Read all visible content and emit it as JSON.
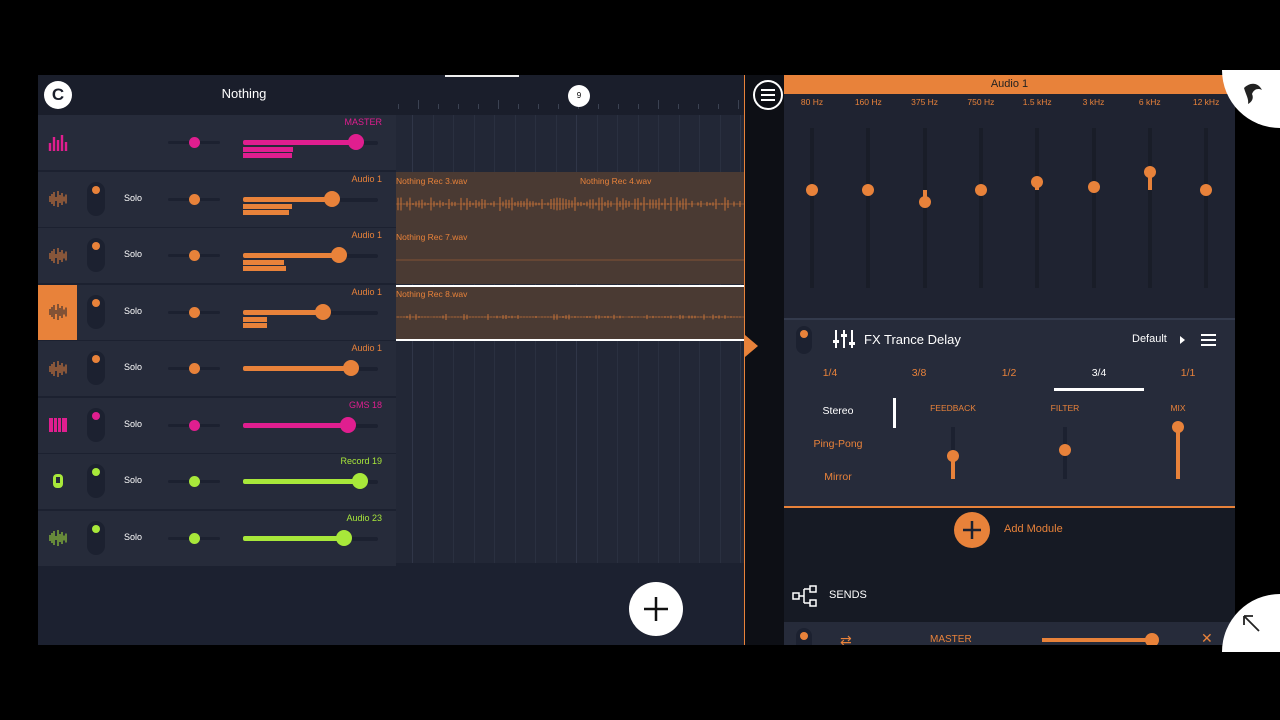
{
  "colors": {
    "accent": "#e8823a",
    "magenta": "#e01e8f",
    "lime": "#a8e83a",
    "panel": "#262b3a",
    "bg": "#1c2130"
  },
  "header": {
    "logo_icon": "fl-logo-icon",
    "project_title": "Nothing",
    "playhead_label": "9",
    "menu_icon": "hamburger-menu-icon"
  },
  "tracks": [
    {
      "name": "MASTER",
      "color": "#e01e8f",
      "icon": "mixer-bars-icon",
      "has_solo": false,
      "solo_label": "",
      "volume": 0.84,
      "meters": [
        0.75,
        0.37,
        0.36
      ],
      "selected": false
    },
    {
      "name": "Audio 1",
      "color": "#e8823a",
      "icon": "waveform-icon",
      "has_solo": true,
      "solo_label": "Solo",
      "volume": 0.66,
      "meters": [
        0.66,
        0.36,
        0.34
      ],
      "selected": false
    },
    {
      "name": "Audio 1",
      "color": "#e8823a",
      "icon": "waveform-icon",
      "has_solo": true,
      "solo_label": "Solo",
      "volume": 0.71,
      "meters": [
        0.7,
        0.3,
        0.32
      ],
      "selected": false
    },
    {
      "name": "Audio 1",
      "color": "#e8823a",
      "icon": "waveform-icon",
      "has_solo": true,
      "solo_label": "Solo",
      "volume": 0.59,
      "meters": [
        0.58,
        0.18,
        0.18
      ],
      "selected": true
    },
    {
      "name": "Audio 1",
      "color": "#e8823a",
      "icon": "waveform-icon",
      "has_solo": true,
      "solo_label": "Solo",
      "volume": 0.8,
      "meters": [
        0.8
      ],
      "selected": false
    },
    {
      "name": "GMS 18",
      "color": "#e01e8f",
      "icon": "piano-keys-icon",
      "has_solo": true,
      "solo_label": "Solo",
      "volume": 0.78,
      "meters": [
        0.78
      ],
      "selected": false
    },
    {
      "name": "Record 19",
      "color": "#a8e83a",
      "icon": "microphone-icon",
      "has_solo": true,
      "solo_label": "Solo",
      "volume": 0.87,
      "meters": [
        0.87
      ],
      "selected": false
    },
    {
      "name": "Audio 23",
      "color": "#a8e83a",
      "icon": "waveform-icon",
      "has_solo": true,
      "solo_label": "Solo",
      "volume": 0.75,
      "meters": [
        0.75
      ],
      "selected": false
    }
  ],
  "clips": [
    {
      "track": 1,
      "labels": [
        "Nothing Rec 3.wav",
        "Nothing Rec 4.wav"
      ],
      "wave": "dense"
    },
    {
      "track": 2,
      "labels": [
        "Nothing Rec 7.wav"
      ],
      "wave": "flat"
    },
    {
      "track": 3,
      "labels": [
        "Nothing Rec 8.wav"
      ],
      "wave": "sparse"
    }
  ],
  "eq": {
    "title": "Audio 1",
    "bands": [
      {
        "freq": "80 Hz",
        "gain": 0.0
      },
      {
        "freq": "160 Hz",
        "gain": 0.0
      },
      {
        "freq": "375 Hz",
        "gain": -0.15
      },
      {
        "freq": "750 Hz",
        "gain": 0.0
      },
      {
        "freq": "1.5 kHz",
        "gain": 0.1
      },
      {
        "freq": "3 kHz",
        "gain": 0.04
      },
      {
        "freq": "6 kHz",
        "gain": 0.22
      },
      {
        "freq": "12 kHz",
        "gain": 0.0
      }
    ]
  },
  "fx": {
    "icon": "sliders-icon",
    "name": "FX Trance Delay",
    "preset": "Default",
    "time_options": [
      "1/4",
      "3/8",
      "1/2",
      "3/4",
      "1/1"
    ],
    "time_selected": "3/4",
    "modes": [
      "Stereo",
      "Ping-Pong",
      "Mirror"
    ],
    "mode_selected": "Stereo",
    "params": [
      {
        "label": "FEEDBACK",
        "value": 0.45
      },
      {
        "label": "FILTER",
        "value": 0.55
      },
      {
        "label": "MIX",
        "value": 1.0
      }
    ]
  },
  "add_module": {
    "label": "Add Module"
  },
  "sends": {
    "label": "SENDS",
    "rows": [
      {
        "name": "MASTER",
        "level": 0.92
      }
    ]
  }
}
